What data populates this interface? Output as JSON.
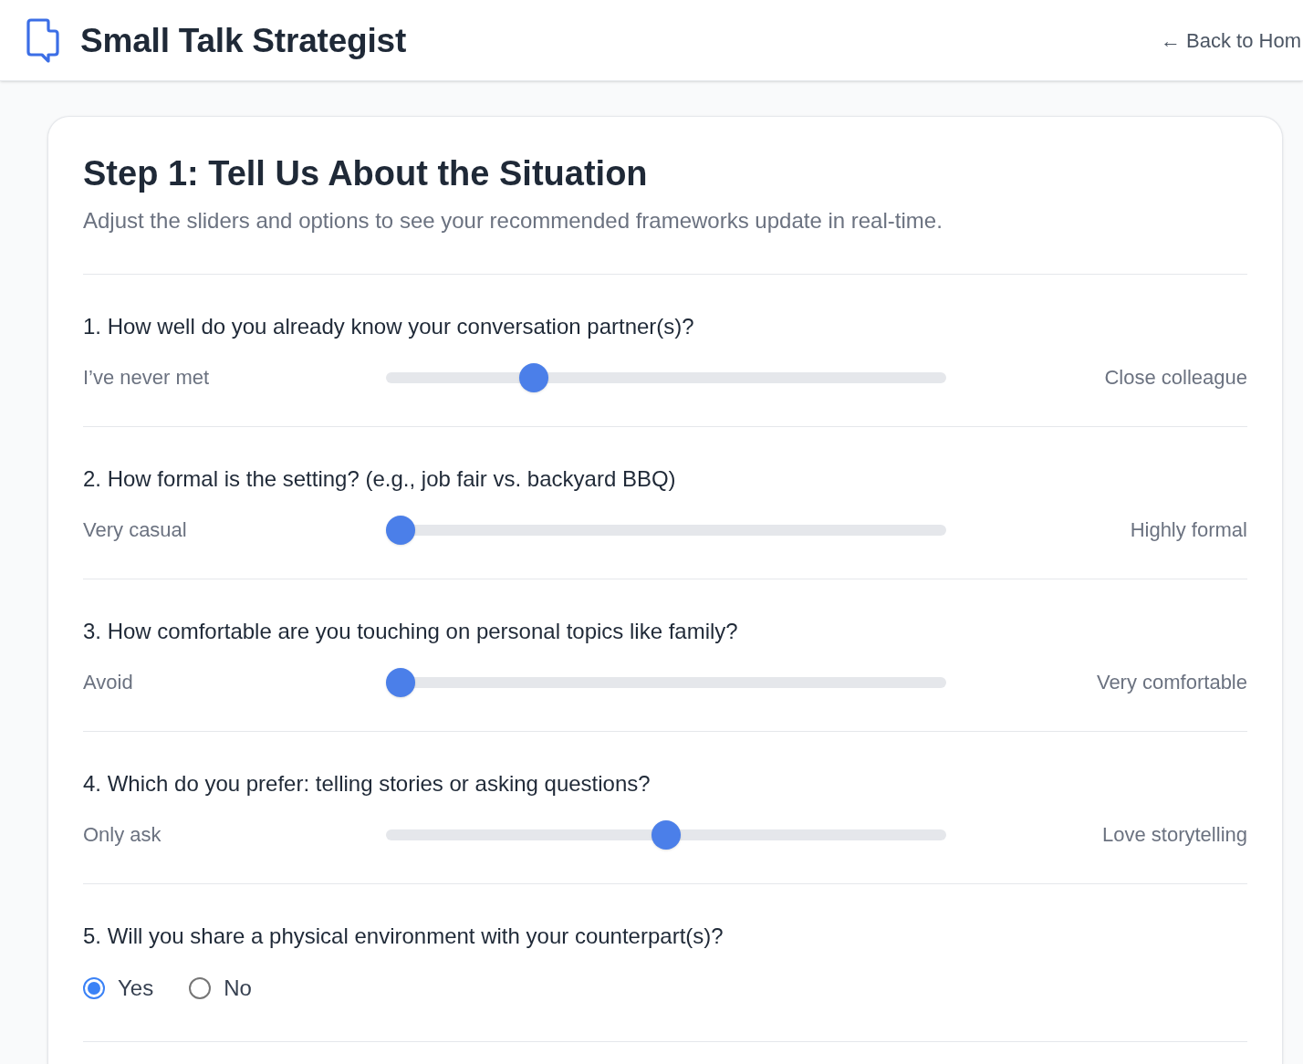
{
  "header": {
    "title": "Small Talk Strategist",
    "back_link": "← Back to Hom"
  },
  "step": {
    "title": "Step 1: Tell Us About the Situation",
    "subtitle": "Adjust the sliders and options to see your recommended frameworks update in real-time."
  },
  "questions": [
    {
      "kind": "slider",
      "label": "1. How well do you already know your conversation partner(s)?",
      "min_label": "I’ve never met",
      "max_label": "Close colleague",
      "level": 0.25
    },
    {
      "kind": "slider",
      "label": "2. How formal is the setting? (e.g., job fair vs. backyard BBQ)",
      "min_label": "Very casual",
      "max_label": "Highly formal",
      "level": 0
    },
    {
      "kind": "slider",
      "label": "3. How comfortable are you touching on personal topics like family?",
      "min_label": "Avoid",
      "max_label": "Very comfortable",
      "level": 0
    },
    {
      "kind": "slider",
      "label": "4. Which do you prefer: telling stories or asking questions?",
      "min_label": "Only ask",
      "max_label": "Love storytelling",
      "level": 0.5
    },
    {
      "kind": "radio",
      "label": "5. Will you share a physical environment with your counterpart(s)?",
      "options": [
        {
          "label": "Yes",
          "selected": true
        },
        {
          "label": "No",
          "selected": false
        }
      ]
    }
  ]
}
